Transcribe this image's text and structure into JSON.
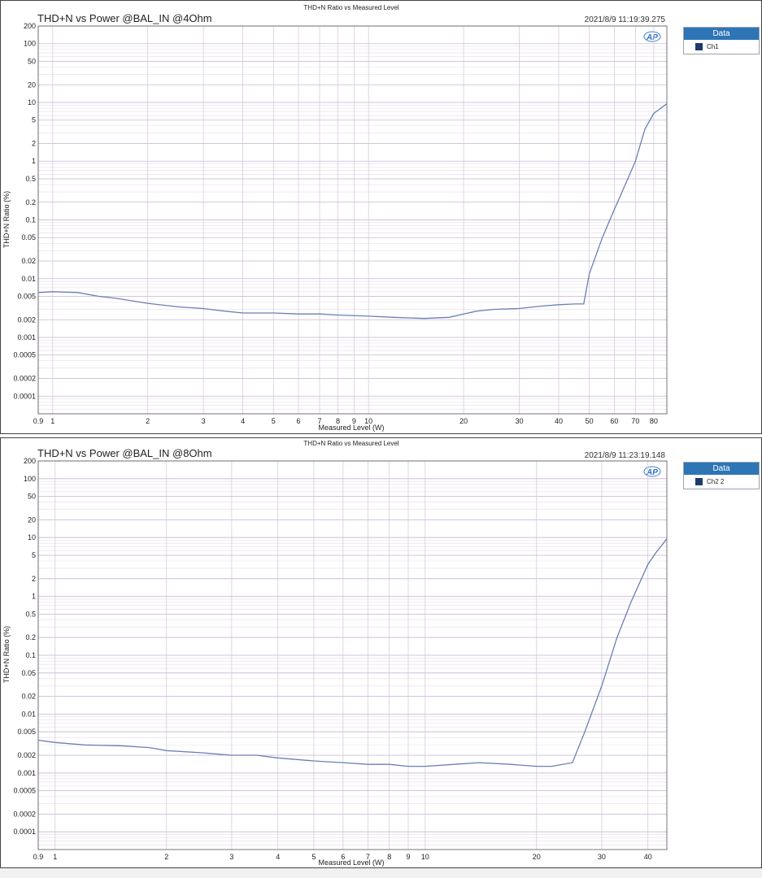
{
  "chart_data": [
    {
      "type": "line",
      "header": "THD+N Ratio vs Measured Level",
      "title": "THD+N vs Power @BAL_IN @4Ohm",
      "timestamp": "2021/8/9 11:19:39.275",
      "logo": "AP",
      "xlabel": "Measured Level (W)",
      "ylabel": "THD+N Ratio (%)",
      "xscale": "log",
      "yscale": "log",
      "xlim": [
        0.9,
        88
      ],
      "ylim": [
        5e-05,
        200
      ],
      "xticks": [
        "0.9",
        "1",
        "2",
        "3",
        "4",
        "5",
        "6",
        "7",
        "8",
        "9",
        "10",
        "20",
        "30",
        "40",
        "50",
        "60",
        "70",
        "80"
      ],
      "xtick_values": [
        0.9,
        1,
        2,
        3,
        4,
        5,
        6,
        7,
        8,
        9,
        10,
        20,
        30,
        40,
        50,
        60,
        70,
        80
      ],
      "yticks": [
        "200",
        "100",
        "50",
        "20",
        "10",
        "5",
        "2",
        "1",
        "0.5",
        "0.2",
        "0.1",
        "0.05",
        "0.02",
        "0.01",
        "0.005",
        "0.002",
        "0.001",
        "0.0005",
        "0.0002",
        "0.0001"
      ],
      "ytick_values": [
        200,
        100,
        50,
        20,
        10,
        5,
        2,
        1,
        0.5,
        0.2,
        0.1,
        0.05,
        0.02,
        0.01,
        0.005,
        0.002,
        0.001,
        0.0005,
        0.0002,
        0.0001
      ],
      "grid": true,
      "legend": {
        "title": "Data",
        "position": "right",
        "entries": [
          "Ch1"
        ]
      },
      "color": "#6b7fb5",
      "series": [
        {
          "name": "Ch1",
          "x": [
            0.9,
            1.0,
            1.2,
            1.4,
            1.6,
            2.0,
            2.5,
            3.0,
            3.5,
            4.0,
            5.0,
            6.0,
            7.0,
            8.0,
            10.0,
            12.0,
            15.0,
            18.0,
            20.0,
            22.0,
            25.0,
            30.0,
            35.0,
            40.0,
            45.0,
            48.0,
            50.0,
            55.0,
            60.0,
            65.0,
            70.0,
            75.0,
            80.0,
            88.0
          ],
          "y": [
            0.0058,
            0.006,
            0.0058,
            0.005,
            0.0046,
            0.0038,
            0.0033,
            0.0031,
            0.0028,
            0.0026,
            0.0026,
            0.0025,
            0.0025,
            0.0024,
            0.0023,
            0.0022,
            0.0021,
            0.0022,
            0.0025,
            0.0028,
            0.003,
            0.0031,
            0.0034,
            0.0036,
            0.0037,
            0.0037,
            0.012,
            0.05,
            0.15,
            0.4,
            1.0,
            3.5,
            6.5,
            9.5
          ]
        }
      ]
    },
    {
      "type": "line",
      "header": "THD+N Ratio vs Measured Level",
      "title": "THD+N vs Power @BAL_IN @8Ohm",
      "timestamp": "2021/8/9 11:23:19.148",
      "logo": "AP",
      "xlabel": "Measured Level (W)",
      "ylabel": "THD+N Ratio (%)",
      "xscale": "log",
      "yscale": "log",
      "xlim": [
        0.9,
        45
      ],
      "ylim": [
        5e-05,
        200
      ],
      "xticks": [
        "0.9",
        "1",
        "2",
        "3",
        "4",
        "5",
        "6",
        "7",
        "8",
        "9",
        "10",
        "20",
        "30",
        "40"
      ],
      "xtick_values": [
        0.9,
        1,
        2,
        3,
        4,
        5,
        6,
        7,
        8,
        9,
        10,
        20,
        30,
        40
      ],
      "yticks": [
        "200",
        "100",
        "50",
        "20",
        "10",
        "5",
        "2",
        "1",
        "0.5",
        "0.2",
        "0.1",
        "0.05",
        "0.02",
        "0.01",
        "0.005",
        "0.002",
        "0.001",
        "0.0005",
        "0.0002",
        "0.0001"
      ],
      "ytick_values": [
        200,
        100,
        50,
        20,
        10,
        5,
        2,
        1,
        0.5,
        0.2,
        0.1,
        0.05,
        0.02,
        0.01,
        0.005,
        0.002,
        0.001,
        0.0005,
        0.0002,
        0.0001
      ],
      "grid": true,
      "legend": {
        "title": "Data",
        "position": "right",
        "entries": [
          "Ch2 2"
        ]
      },
      "color": "#6b7fb5",
      "series": [
        {
          "name": "Ch2 2",
          "x": [
            0.9,
            1.0,
            1.2,
            1.5,
            1.8,
            2.0,
            2.5,
            3.0,
            3.5,
            4.0,
            5.0,
            6.0,
            7.0,
            8.0,
            9.0,
            10.0,
            12.0,
            14.0,
            17.0,
            20.0,
            22.0,
            25.0,
            27.0,
            30.0,
            33.0,
            36.0,
            40.0,
            42.0,
            45.0
          ],
          "y": [
            0.0036,
            0.0033,
            0.003,
            0.0029,
            0.0027,
            0.0024,
            0.0022,
            0.002,
            0.002,
            0.0018,
            0.0016,
            0.0015,
            0.0014,
            0.0014,
            0.0013,
            0.0013,
            0.0014,
            0.0015,
            0.0014,
            0.0013,
            0.0013,
            0.0015,
            0.005,
            0.03,
            0.2,
            0.8,
            3.5,
            5.5,
            9.5
          ]
        }
      ]
    }
  ]
}
